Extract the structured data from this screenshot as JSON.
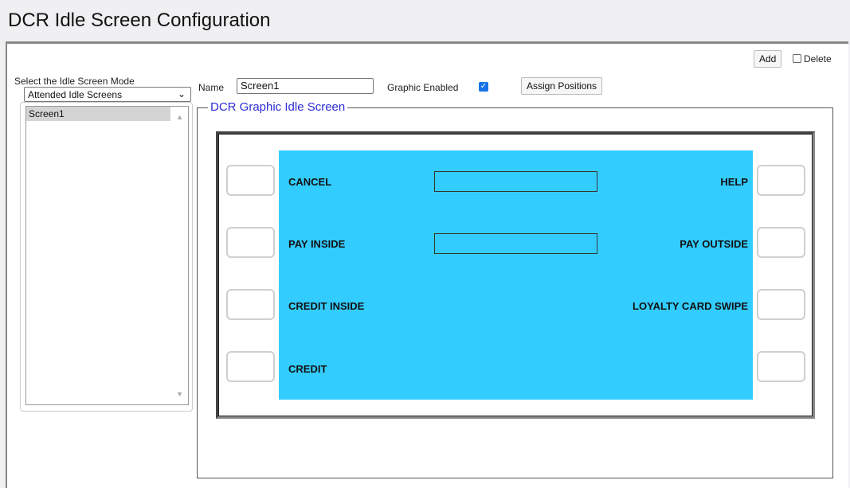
{
  "page": {
    "title": "DCR Idle Screen Configuration"
  },
  "toolbar": {
    "add_label": "Add",
    "delete_label": "Delete",
    "delete_checked": false
  },
  "sidebar": {
    "mode_label": "Select the Idle Screen Mode",
    "mode_value": "Attended Idle Screens",
    "screens": [
      {
        "label": "Screen1",
        "selected": true
      }
    ]
  },
  "form": {
    "name_label": "Name",
    "name_value": "Screen1",
    "graphic_enabled_label": "Graphic Enabled",
    "graphic_enabled_checked": true,
    "assign_positions_label": "Assign Positions"
  },
  "dcr": {
    "legend": "DCR Graphic Idle Screen",
    "screen_color": "#33ccff",
    "left_labels": [
      "CANCEL",
      "PAY INSIDE",
      "CREDIT INSIDE",
      "CREDIT"
    ],
    "right_labels": [
      "HELP",
      "PAY OUTSIDE",
      "LOYALTY CARD SWIPE",
      ""
    ]
  },
  "colors": {
    "accent": "#1a73e8",
    "legend_text": "#2b2bd6"
  }
}
